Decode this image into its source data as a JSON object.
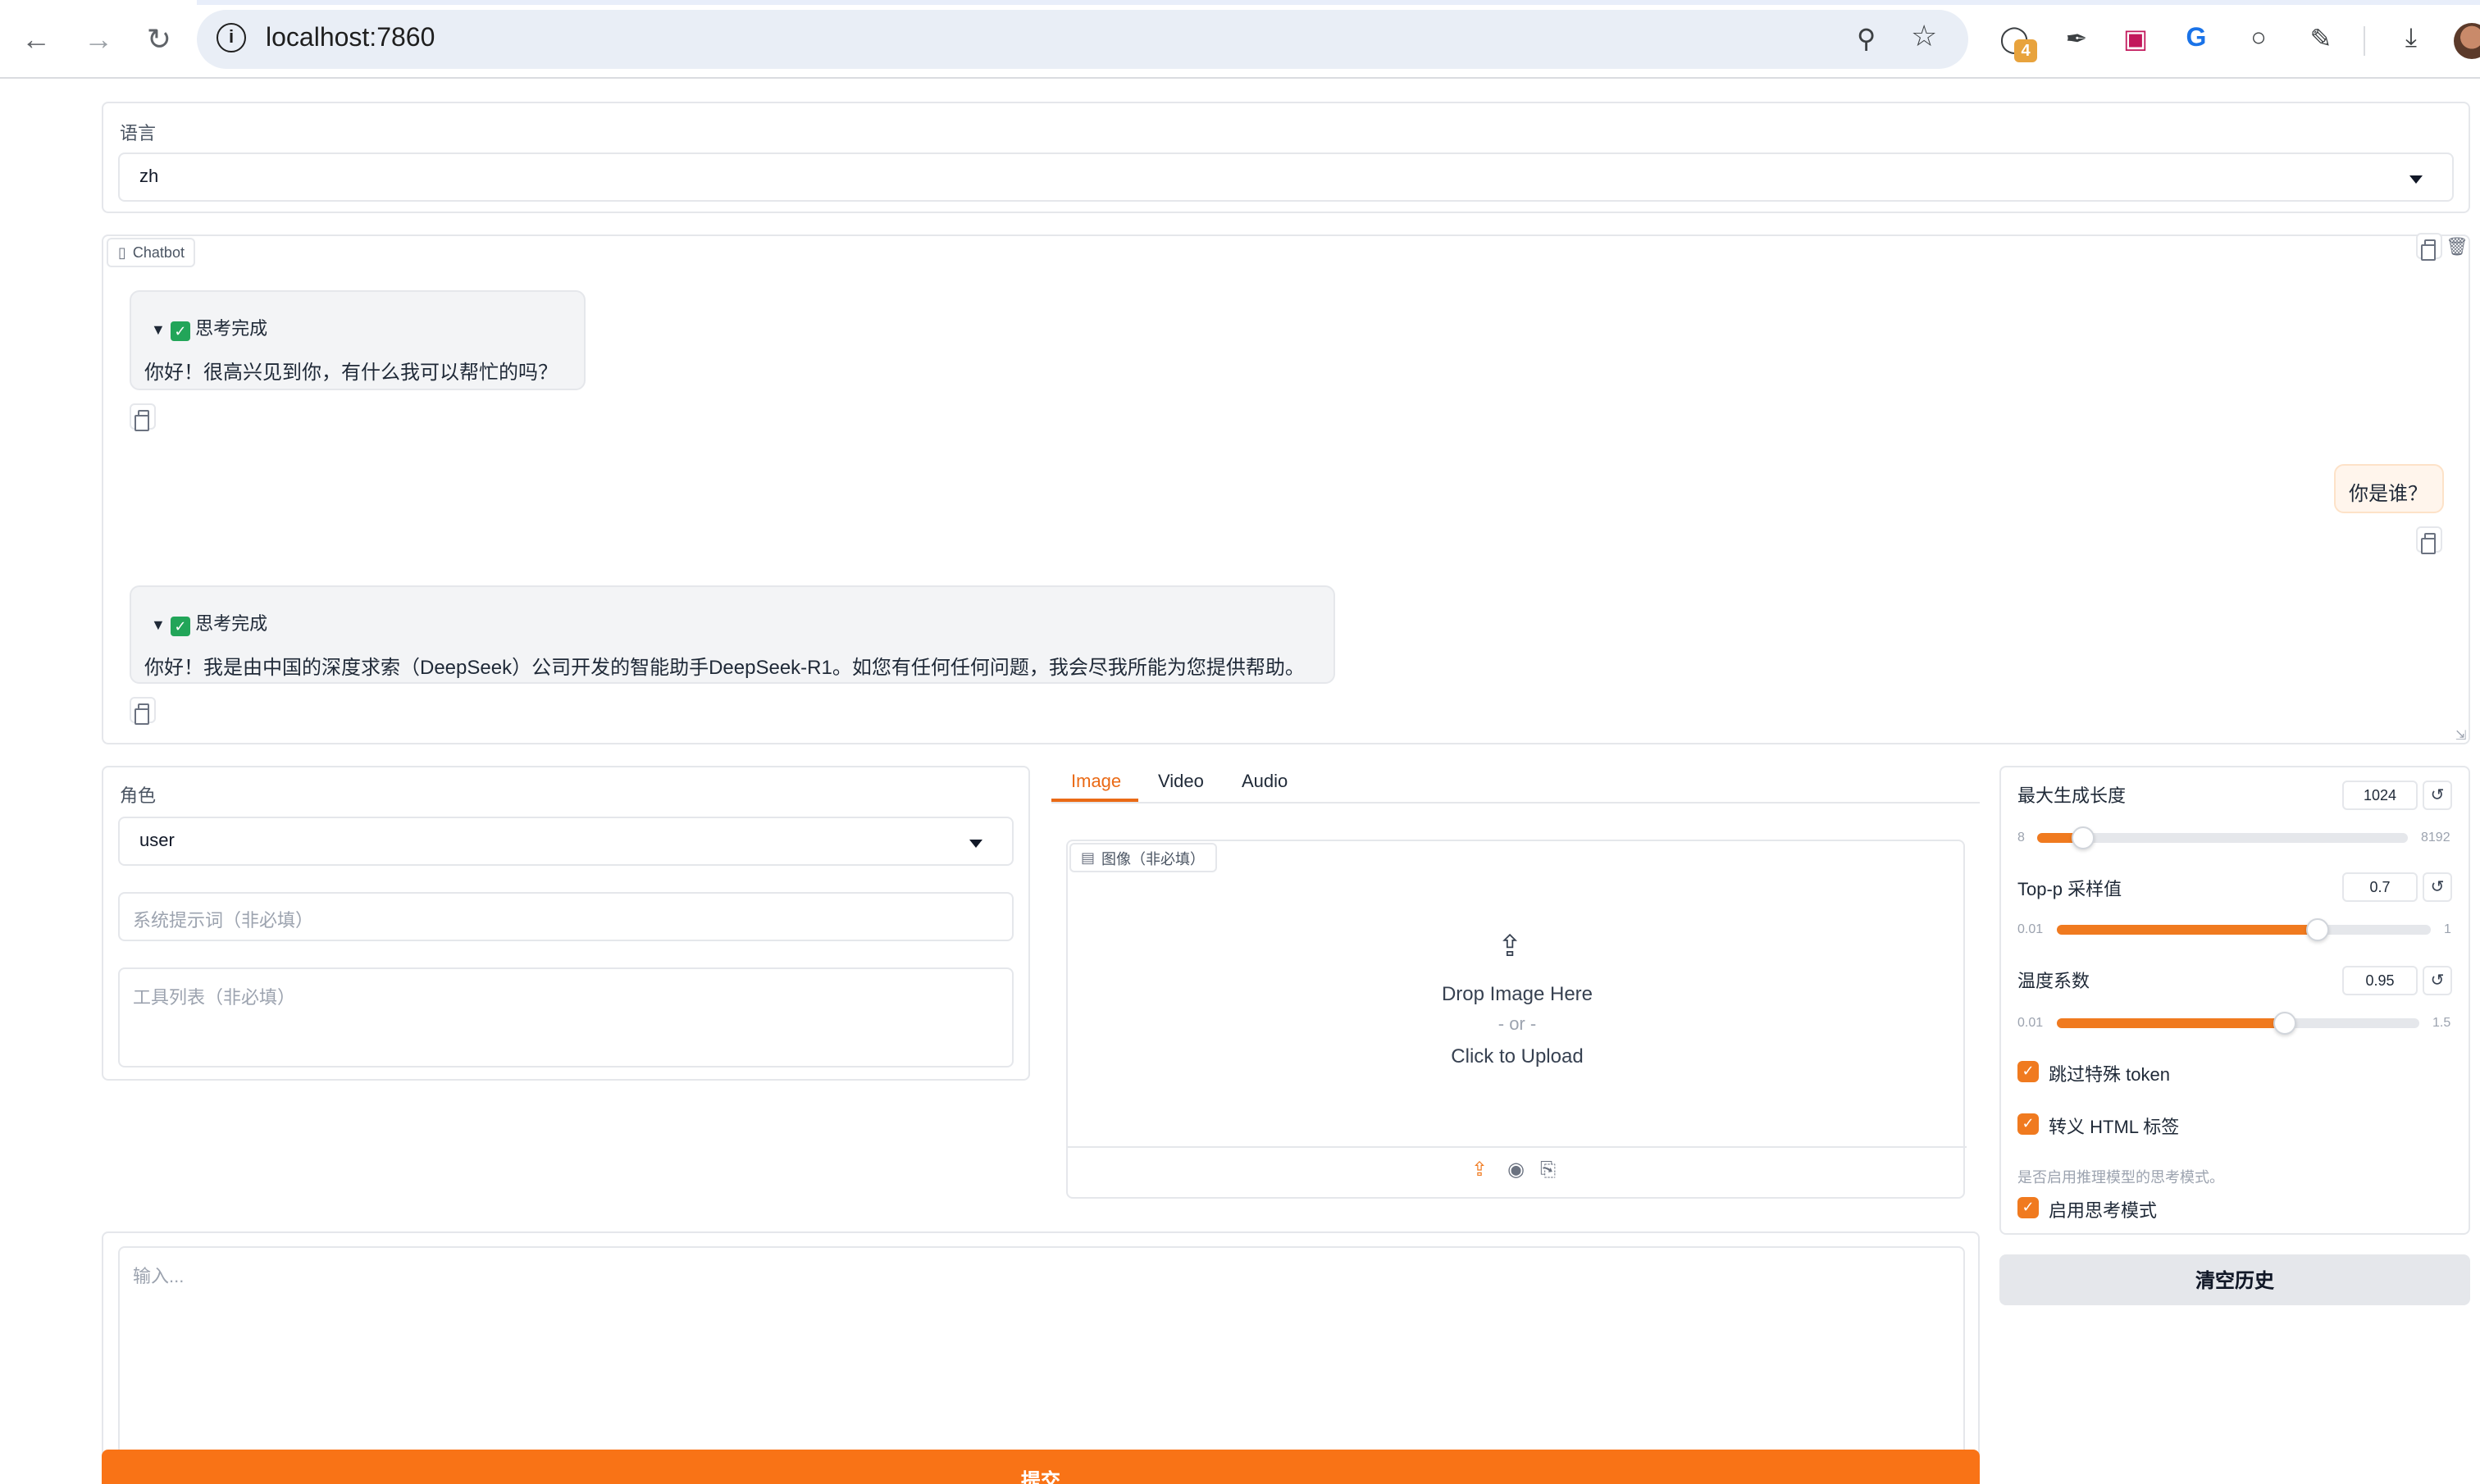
{
  "browser": {
    "url": "localhost:7860",
    "extension_badge": "4"
  },
  "language": {
    "label": "语言",
    "value": "zh"
  },
  "chatbot": {
    "label": "Chatbot",
    "messages": [
      {
        "role": "assistant",
        "thinking": "思考完成",
        "text": "你好！很高兴见到你，有什么我可以帮忙的吗？"
      },
      {
        "role": "user",
        "text": "你是谁？"
      },
      {
        "role": "assistant",
        "thinking": "思考完成",
        "text": "你好！我是由中国的深度求索（DeepSeek）公司开发的智能助手DeepSeek-R1。如您有任何任何问题，我会尽我所能为您提供帮助。"
      }
    ]
  },
  "role": {
    "label": "角色",
    "value": "user"
  },
  "system_prompt": {
    "placeholder": "系统提示词（非必填）"
  },
  "tools": {
    "placeholder": "工具列表（非必填）"
  },
  "media_tabs": {
    "tabs": [
      "Image",
      "Video",
      "Audio"
    ],
    "active": "Image"
  },
  "image_upload": {
    "label": "图像（非必填）",
    "drop_text": "Drop Image Here",
    "or_text": "- or -",
    "click_text": "Click to Upload"
  },
  "sliders": [
    {
      "label": "最大生成长度",
      "value": "1024",
      "min": "8",
      "max": "8192",
      "fraction": 0.123
    },
    {
      "label": "Top-p 采样值",
      "value": "0.7",
      "min": "0.01",
      "max": "1",
      "fraction": 0.697
    },
    {
      "label": "温度系数",
      "value": "0.95",
      "min": "0.01",
      "max": "1.5",
      "fraction": 0.631
    }
  ],
  "checkboxes": {
    "skip_special": {
      "label": "跳过特殊 token",
      "checked": true
    },
    "escape_html": {
      "label": "转义 HTML 标签",
      "checked": true
    },
    "thinking_info": "是否启用推理模型的思考模式。",
    "enable_thinking": {
      "label": "启用思考模式",
      "checked": true
    }
  },
  "input": {
    "placeholder": "输入..."
  },
  "buttons": {
    "clear_history": "清空历史",
    "submit": "提交"
  },
  "colors": {
    "accent": "#f97316",
    "check": "#22a559"
  }
}
